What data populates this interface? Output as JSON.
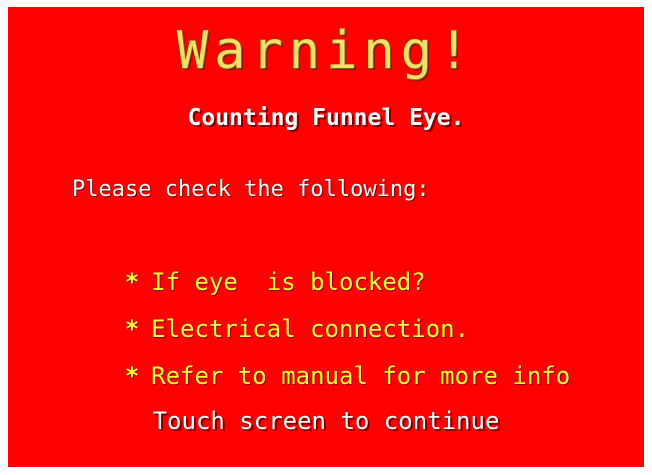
{
  "colors": {
    "background": "#ff0000",
    "title": "#f3e06a",
    "subtitle": "#ffffff",
    "checklist": "#ffff33",
    "continue": "#ffffff"
  },
  "alert": {
    "title": "Warning!",
    "subtitle": "Counting Funnel Eye.",
    "instruction": "Please check the following:",
    "bullet_symbol": "*",
    "checklist": [
      "If eye  is blocked?",
      "Electrical connection.",
      "Refer to manual for more info"
    ],
    "continue_prompt": "Touch screen to continue"
  }
}
